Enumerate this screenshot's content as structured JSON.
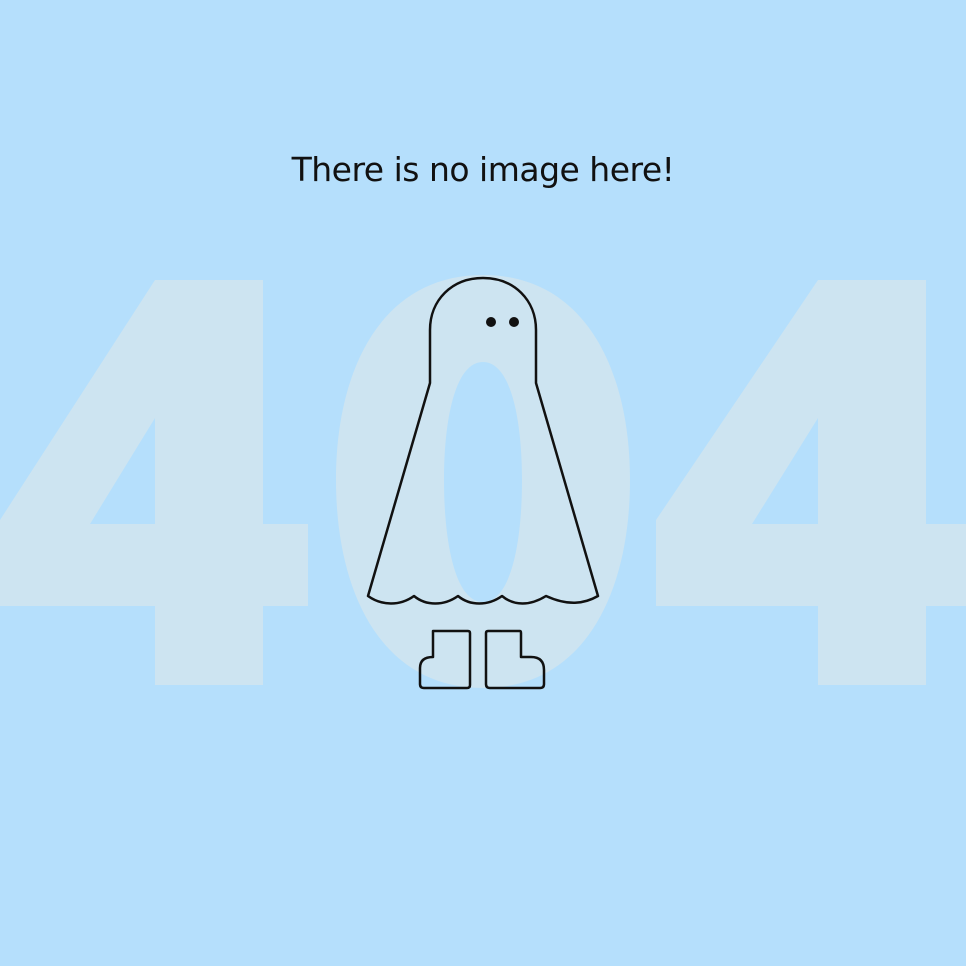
{
  "message": {
    "text": "There is no image here!"
  },
  "background": {
    "digits": [
      "4",
      "0",
      "4"
    ],
    "page_color": "#b5dffc",
    "digit_color": "#cde4f1",
    "stroke_color": "#111111"
  },
  "illustration": {
    "icon": "ghost-icon",
    "boots_icon": "boots-icon"
  }
}
